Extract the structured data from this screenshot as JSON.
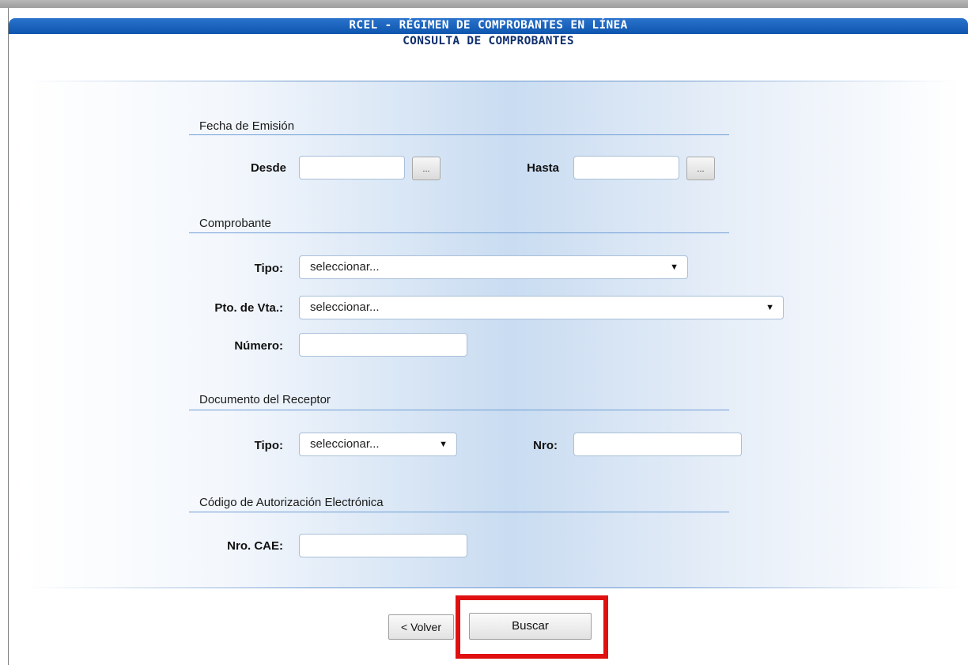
{
  "header": {
    "title": "RCEL - RÉGIMEN DE COMPROBANTES EN LÍNEA",
    "subtitle": "CONSULTA DE COMPROBANTES"
  },
  "fecha": {
    "section": "Fecha de Emisión",
    "desde_label": "Desde",
    "hasta_label": "Hasta",
    "desde_value": "",
    "hasta_value": "",
    "picker_label": "..."
  },
  "comprobante": {
    "section": "Comprobante",
    "tipo_label": "Tipo:",
    "tipo_value": "seleccionar...",
    "pto_label": "Pto. de Vta.:",
    "pto_value": "seleccionar...",
    "numero_label": "Número:",
    "numero_value": ""
  },
  "receptor": {
    "section": "Documento del Receptor",
    "tipo_label": "Tipo:",
    "tipo_value": "seleccionar...",
    "nro_label": "Nro:",
    "nro_value": ""
  },
  "cae": {
    "section": "Código de Autorización Electrónica",
    "label": "Nro. CAE:",
    "value": ""
  },
  "actions": {
    "volver_label": "< Volver",
    "buscar_label": "Buscar"
  },
  "icons": {
    "dropdown_arrow": "▼"
  },
  "colors": {
    "header_band": "#0d55ad",
    "subtitle_text": "#0e2e6d",
    "highlight": "#e01010"
  }
}
